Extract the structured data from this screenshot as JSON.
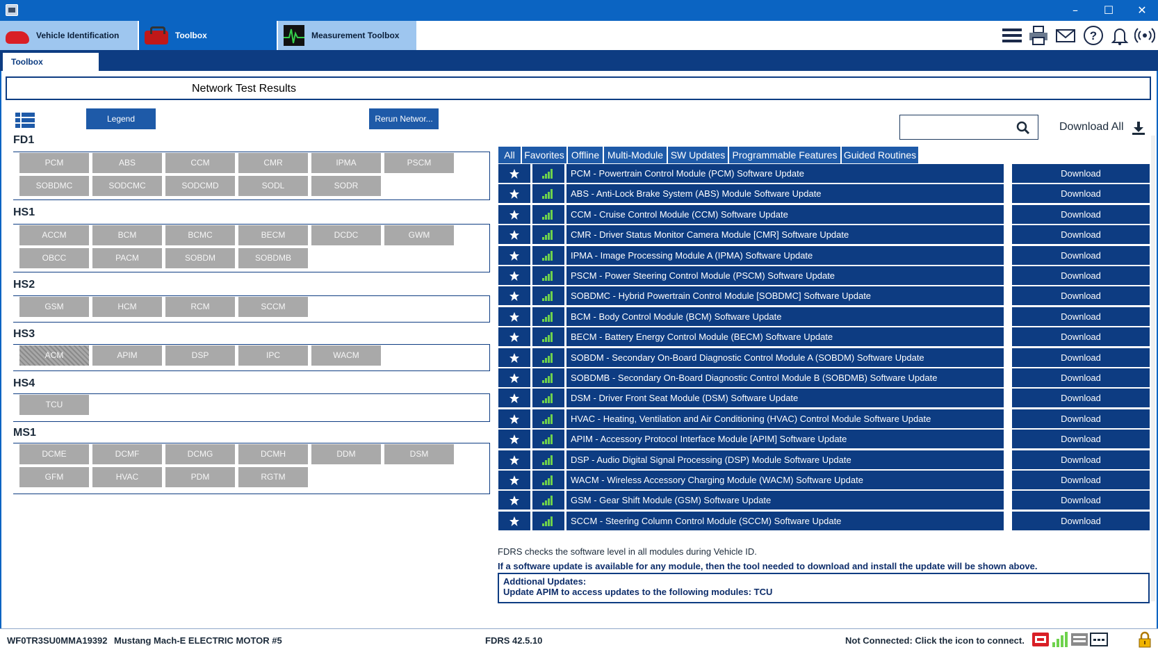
{
  "window": {
    "minimize": "–",
    "maximize": "☐",
    "close": "✕"
  },
  "app_tabs": [
    {
      "label": "Vehicle Identification"
    },
    {
      "label": "Toolbox"
    },
    {
      "label": "Measurement Toolbox"
    }
  ],
  "top_icons": [
    "menu-icon",
    "printer-icon",
    "mail-icon",
    "help-icon",
    "bell-icon",
    "wireless-icon"
  ],
  "subtab": {
    "label": "Toolbox"
  },
  "panel_title": "Network Test Results",
  "buttons": {
    "legend": "Legend",
    "rerun": "Rerun Networ..."
  },
  "groups": [
    {
      "name": "FD1",
      "modules": [
        "PCM",
        "ABS",
        "CCM",
        "CMR",
        "IPMA",
        "PSCM",
        "SOBDMC",
        "SODCMC",
        "SODCMD",
        "SODL",
        "SODR"
      ]
    },
    {
      "name": "HS1",
      "modules": [
        "ACCM",
        "BCM",
        "BCMC",
        "BECM",
        "DCDC",
        "GWM",
        "OBCC",
        "PACM",
        "SOBDM",
        "SOBDMB"
      ]
    },
    {
      "name": "HS2",
      "modules": [
        "GSM",
        "HCM",
        "RCM",
        "SCCM"
      ]
    },
    {
      "name": "HS3",
      "modules": [
        "ACM",
        "APIM",
        "DSP",
        "IPC",
        "WACM"
      ]
    },
    {
      "name": "HS4",
      "modules": [
        "TCU"
      ]
    },
    {
      "name": "MS1",
      "modules": [
        "DCME",
        "DCMF",
        "DCMG",
        "DCMH",
        "DDM",
        "DSM",
        "GFM",
        "HVAC",
        "PDM",
        "RGTM"
      ]
    }
  ],
  "search": {
    "placeholder": ""
  },
  "download_all": "Download All",
  "filter_tabs": [
    "All",
    "Favorites",
    "Offline",
    "Multi-Module",
    "SW Updates",
    "Programmable Features",
    "Guided Routines"
  ],
  "download_label": "Download",
  "updates": [
    "PCM - Powertrain Control Module (PCM) Software Update",
    "ABS - Anti-Lock Brake System (ABS) Module Software Update",
    "CCM - Cruise Control Module (CCM) Software Update",
    "CMR - Driver Status Monitor Camera Module [CMR] Software Update",
    "IPMA - Image Processing Module A (IPMA) Software Update",
    "PSCM - Power Steering Control Module (PSCM) Software Update",
    "SOBDMC - Hybrid Powertrain Control Module [SOBDMC] Software Update",
    "BCM - Body Control Module (BCM) Software Update",
    "BECM - Battery Energy Control Module (BECM) Software Update",
    "SOBDM - Secondary On-Board Diagnostic Control Module A (SOBDM) Software Update",
    "SOBDMB - Secondary On-Board Diagnostic Control Module B (SOBDMB) Software Update",
    "DSM - Driver Front Seat Module (DSM) Software Update",
    "HVAC - Heating, Ventilation and Air Conditioning (HVAC) Control Module Software Update",
    "APIM - Accessory Protocol Interface Module [APIM] Software Update",
    "DSP - Audio Digital Signal Processing (DSP) Module Software Update",
    "WACM - Wireless Accessory Charging Module (WACM) Software Update",
    "GSM - Gear Shift Module (GSM) Software Update",
    "SCCM - Steering Column Control Module (SCCM) Software Update"
  ],
  "info": {
    "line1": "FDRS checks the software level in all modules during Vehicle ID.",
    "line2": "If a software update is available for any module, then the tool needed to download and install the update will be shown above.",
    "addl_title": "Addtional Updates:",
    "addl_text": "Update APIM to access updates to the following modules: TCU"
  },
  "status": {
    "vin": "WF0TR3SU0MMA19392",
    "vehicle": "Mustang Mach-E ELECTRIC MOTOR #5",
    "version": "FDRS 42.5.10",
    "connection": "Not Connected: Click the icon to connect."
  },
  "colors": {
    "accent": "#0b64c2",
    "row": "#0d3c82",
    "module": "#a9a9a9",
    "signal": "#6ed24c"
  }
}
